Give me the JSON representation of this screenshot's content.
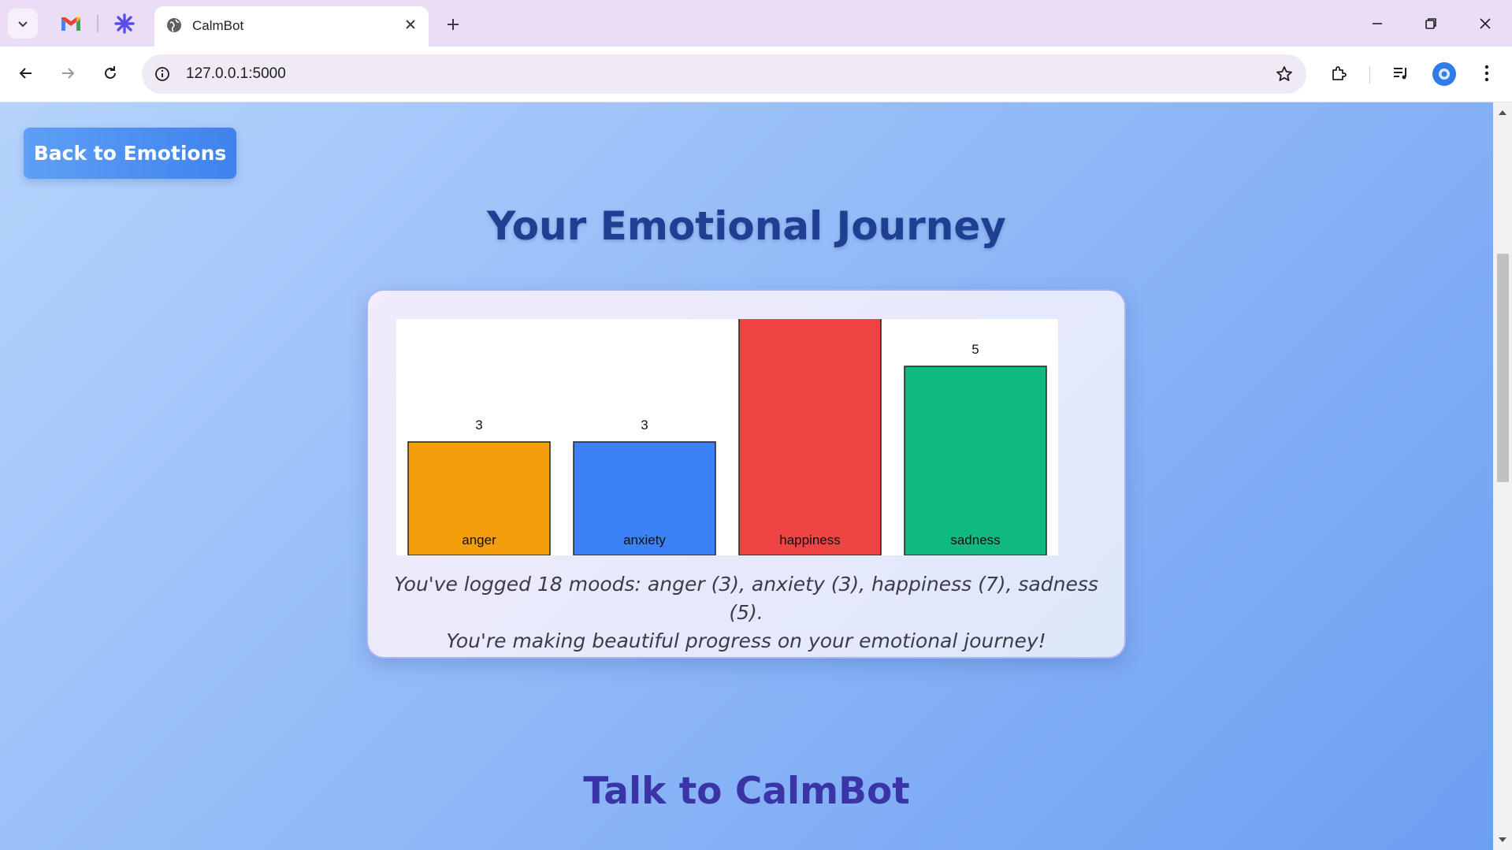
{
  "browser": {
    "tab_title": "CalmBot",
    "url": "127.0.0.1:5000",
    "pinned_tabs": [
      "gmail-icon",
      "asterisk-app-icon"
    ],
    "profile_color": "#2f7be8"
  },
  "page": {
    "back_button_label": "Back to Emotions",
    "title": "Your Emotional Journey",
    "summary_line1": "You've logged 18 moods: anger (3), anxiety (3), happiness (7), sadness (5).",
    "summary_line2": "You're making beautiful progress on your emotional journey!",
    "section_title": "Talk to CalmBot",
    "colors": {
      "title": "#1f3f93",
      "section_title": "#3a34a6",
      "button": "#4a8df1"
    }
  },
  "chart_data": {
    "type": "bar",
    "categories": [
      "anger",
      "anxiety",
      "happiness",
      "sadness"
    ],
    "values": [
      3,
      3,
      7,
      5
    ],
    "colors": [
      "#f59e0b",
      "#3b82f6",
      "#ef4444",
      "#10b981"
    ],
    "title": "",
    "xlabel": "",
    "ylabel": "",
    "ylim": [
      0,
      12
    ],
    "grid": false,
    "legend": "none",
    "labels_inside_bars": true,
    "value_labels_above": true
  }
}
